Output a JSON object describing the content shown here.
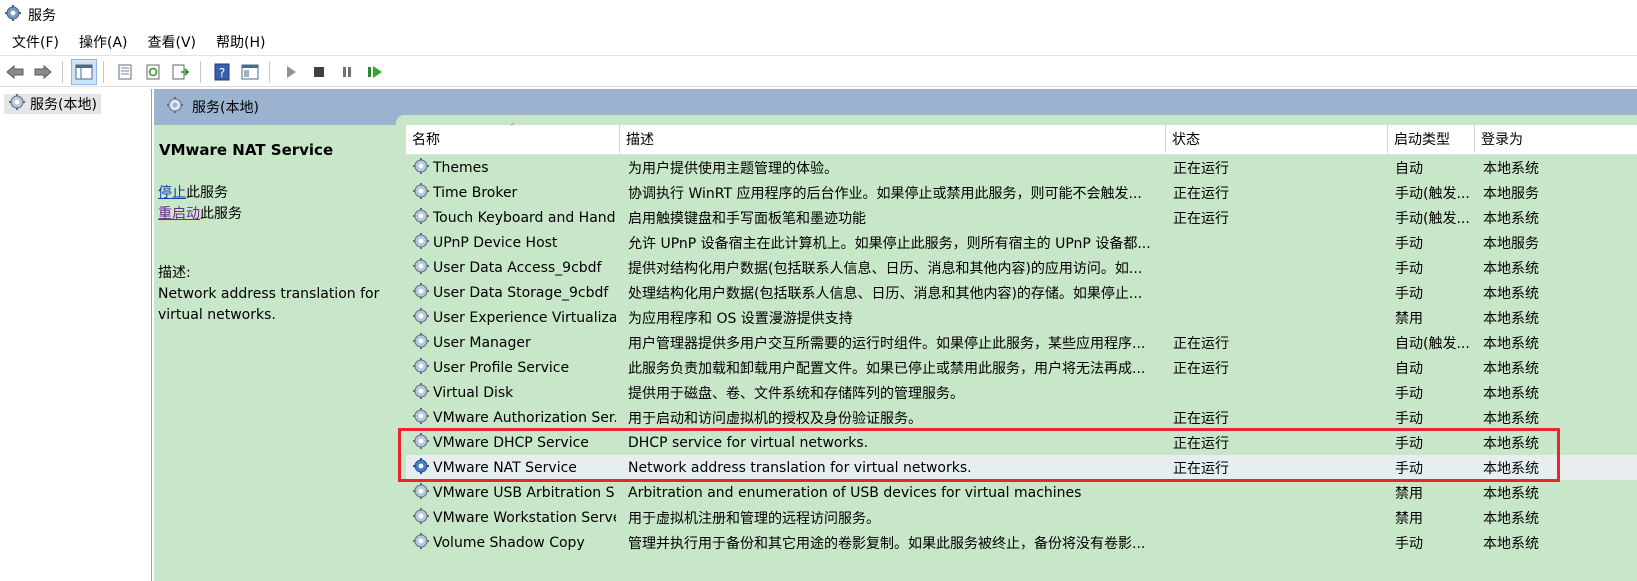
{
  "window": {
    "title": "服务",
    "icon": "gear-icon"
  },
  "menu": [
    "文件(F)",
    "操作(A)",
    "查看(V)",
    "帮助(H)"
  ],
  "toolbar": {
    "buttons": [
      "back-arrow-icon",
      "forward-arrow-icon",
      "console-tree-icon",
      "properties-icon",
      "refresh-icon",
      "export-list-icon",
      "help-icon",
      "console-view-icon",
      "start-service-icon",
      "stop-service-icon",
      "pause-service-icon",
      "restart-service-icon"
    ]
  },
  "tree": {
    "item": "服务(本地)"
  },
  "main": {
    "header": "服务(本地)"
  },
  "side": {
    "service_name": "VMware NAT Service",
    "stop_link": "停止",
    "stop_suffix": "此服务",
    "restart_link": "重启动",
    "restart_suffix": "此服务",
    "desc_label": "描述:",
    "desc_text": "Network address translation for virtual networks."
  },
  "columns": [
    "名称",
    "描述",
    "状态",
    "启动类型",
    "登录为"
  ],
  "services": [
    {
      "name": "Themes",
      "desc": "为用户提供使用主题管理的体验。",
      "status": "正在运行",
      "startup": "自动",
      "logon": "本地系统"
    },
    {
      "name": "Time Broker",
      "desc": "协调执行 WinRT 应用程序的后台作业。如果停止或禁用此服务，则可能不会触发...",
      "status": "正在运行",
      "startup": "手动(触发...",
      "logon": "本地服务"
    },
    {
      "name": "Touch Keyboard and Hand...",
      "desc": "启用触摸键盘和手写面板笔和墨迹功能",
      "status": "正在运行",
      "startup": "手动(触发...",
      "logon": "本地系统"
    },
    {
      "name": "UPnP Device Host",
      "desc": "允许 UPnP 设备宿主在此计算机上。如果停止此服务，则所有宿主的 UPnP 设备都...",
      "status": "",
      "startup": "手动",
      "logon": "本地服务"
    },
    {
      "name": "User Data Access_9cbdf",
      "desc": "提供对结构化用户数据(包括联系人信息、日历、消息和其他内容)的应用访问。如...",
      "status": "",
      "startup": "手动",
      "logon": "本地系统"
    },
    {
      "name": "User Data Storage_9cbdf",
      "desc": "处理结构化用户数据(包括联系人信息、日历、消息和其他内容)的存储。如果停止...",
      "status": "",
      "startup": "手动",
      "logon": "本地系统"
    },
    {
      "name": "User Experience Virtualizat...",
      "desc": "为应用程序和 OS 设置漫游提供支持",
      "status": "",
      "startup": "禁用",
      "logon": "本地系统"
    },
    {
      "name": "User Manager",
      "desc": "用户管理器提供多用户交互所需要的运行时组件。如果停止此服务，某些应用程序...",
      "status": "正在运行",
      "startup": "自动(触发...",
      "logon": "本地系统"
    },
    {
      "name": "User Profile Service",
      "desc": "此服务负责加载和卸载用户配置文件。如果已停止或禁用此服务，用户将无法再成...",
      "status": "正在运行",
      "startup": "自动",
      "logon": "本地系统"
    },
    {
      "name": "Virtual Disk",
      "desc": "提供用于磁盘、卷、文件系统和存储阵列的管理服务。",
      "status": "",
      "startup": "手动",
      "logon": "本地系统"
    },
    {
      "name": "VMware Authorization Ser...",
      "desc": "用于启动和访问虚拟机的授权及身份验证服务。",
      "status": "正在运行",
      "startup": "手动",
      "logon": "本地系统"
    },
    {
      "name": "VMware DHCP Service",
      "desc": "DHCP service for virtual networks.",
      "status": "正在运行",
      "startup": "手动",
      "logon": "本地系统"
    },
    {
      "name": "VMware NAT Service",
      "desc": "Network address translation for virtual networks.",
      "status": "正在运行",
      "startup": "手动",
      "logon": "本地系统"
    },
    {
      "name": "VMware USB Arbitration S...",
      "desc": "Arbitration and enumeration of USB devices for virtual machines",
      "status": "",
      "startup": "禁用",
      "logon": "本地系统"
    },
    {
      "name": "VMware Workstation Server",
      "desc": "用于虚拟机注册和管理的远程访问服务。",
      "status": "",
      "startup": "禁用",
      "logon": "本地系统"
    },
    {
      "name": "Volume Shadow Copy",
      "desc": "管理并执行用于备份和其它用途的卷影复制。如果此服务被终止，备份将没有卷影...",
      "status": "",
      "startup": "手动",
      "logon": "本地系统"
    }
  ],
  "selected_service": "VMware NAT Service",
  "colors": {
    "list_bg": "#c8e6c8",
    "header_bg": "#9bb3cf",
    "highlight": "#e8262b",
    "link": "#0645ad"
  }
}
